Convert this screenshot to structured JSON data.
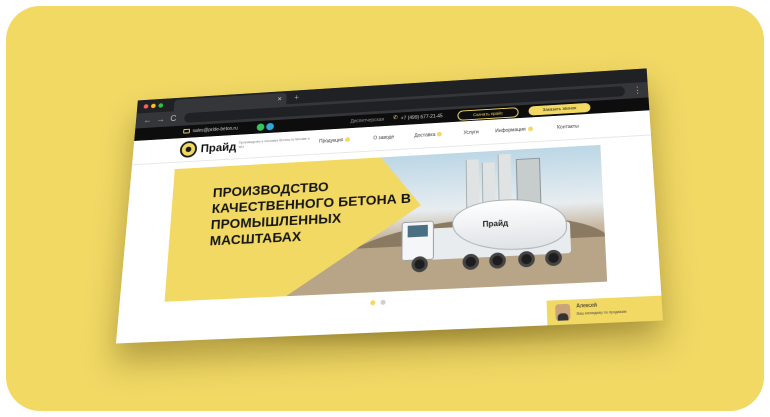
{
  "colors": {
    "background": "#f2d964",
    "accent": "#f2d964",
    "topbar": "#0d0d0d",
    "browser_chrome": "#202124"
  },
  "browser": {
    "tab_title": "",
    "tab_close": "×",
    "new_tab": "+",
    "nav": {
      "back": "←",
      "forward": "→",
      "reload": "C"
    },
    "menu": "⋮"
  },
  "topbar": {
    "email": "sales@pride-beton.ru",
    "hours_label": "Диспетчерская",
    "phone": "+7 (499) 677-21-45",
    "price_button": "Скачать прайс",
    "order_button": "Заказать звонок"
  },
  "header": {
    "logo_text": "Прайд",
    "logo_subtitle": "Производство и поставка бетона по Москве и МО",
    "nav": [
      {
        "label": "Продукция",
        "has_dropdown": true
      },
      {
        "label": "О заводе",
        "has_dropdown": false
      },
      {
        "label": "Доставка",
        "has_dropdown": true
      },
      {
        "label": "Услуги",
        "has_dropdown": false
      },
      {
        "label": "Информация",
        "has_dropdown": true
      },
      {
        "label": "Контакты",
        "has_dropdown": false
      }
    ]
  },
  "hero": {
    "headline_lines": [
      "ПРОИЗВОДСТВО",
      "КАЧЕСТВЕННОГО БЕТОНА В",
      "ПРОМЫШЛЕННЫХ",
      "МАСШТАБАХ"
    ],
    "truck_logo": "Прайд"
  },
  "slider": {
    "slides": 2,
    "active_index": 0
  },
  "chat_widget": {
    "name": "Алексей",
    "role": "Ваш менеджер по продажам"
  }
}
